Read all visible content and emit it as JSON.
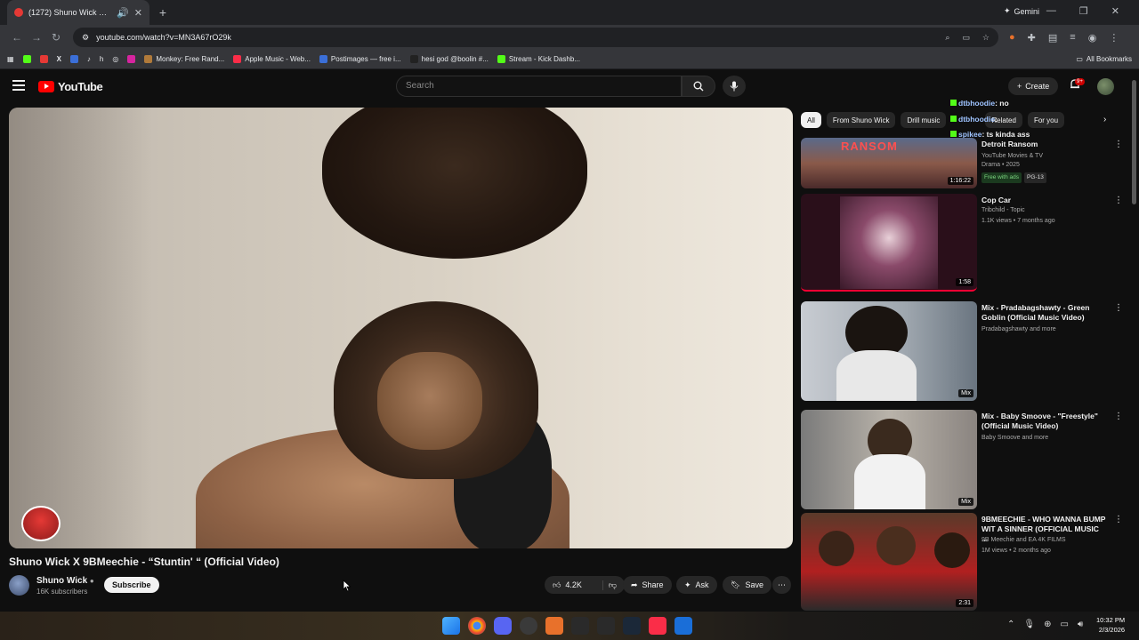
{
  "browser": {
    "tab_title": "(1272) Shuno Wick X 9BMe...",
    "gemini_label": "Gemini",
    "url": "youtube.com/watch?v=MN3A67rO29k"
  },
  "bookmarks": [
    {
      "label": "Monkey: Free Rand...",
      "color": "#b07a3a"
    },
    {
      "label": "Apple Music - Web...",
      "color": "#fa2d48"
    },
    {
      "label": "Postimages — free i...",
      "color": "#3b6fd8"
    },
    {
      "label": "hesi god @boolin #...",
      "color": "#222222"
    },
    {
      "label": "Stream - Kick Dashb...",
      "color": "#53fc18"
    }
  ],
  "all_bookmarks": "All Bookmarks",
  "youtube": {
    "logo_text": "YouTube",
    "search_placeholder": "Search",
    "create_label": "Create",
    "notif_badge": "9+"
  },
  "video": {
    "title": "Shuno Wick X 9BMeechie - “Stuntin' “ (Official Video)",
    "channel": "Shuno Wick",
    "subscribers": "16K subscribers",
    "subscribe_label": "Subscribe",
    "likes": "4.2K",
    "share_label": "Share",
    "ask_label": "Ask",
    "save_label": "Save"
  },
  "chips": [
    "All",
    "From Shuno Wick",
    "Drill music",
    "Related",
    "For you"
  ],
  "chat": [
    {
      "user": "dtbhoodie",
      "msg": ": no"
    },
    {
      "user": "dtbhoodie",
      "msg": ": "
    },
    {
      "user": "spikee",
      "msg": ": ts kinda ass"
    }
  ],
  "recommendations": [
    {
      "title": "Detroit Ransom",
      "meta1": "YouTube Movies & TV",
      "meta2": "Drama • 2025",
      "free": "Free with ads",
      "rating": "PG-13",
      "duration": "1:16:22"
    },
    {
      "title": "Cop Car",
      "meta1": "Tribchild - Topic",
      "meta2": "1.1K views • 7 months ago",
      "duration": "1:58"
    },
    {
      "title": "Mix - Pradabagshawty - Green Goblin (Official Music Video)",
      "meta1": "Pradabagshawty and more",
      "meta2": "",
      "duration": "Mix"
    },
    {
      "title": "Mix - Baby Smoove - \"Freestyle\" (Official Music Video)",
      "meta1": "Baby Smoove and more",
      "meta2": "",
      "duration": "Mix"
    },
    {
      "title": "9BMEECHIE - WHO WANNA BUMP WIT A SINNER (OFFICIAL MUSIC ...",
      "meta1": "9B Meechie and EA 4K FILMS",
      "meta2": "1M views • 2 months ago",
      "duration": "2:31"
    }
  ],
  "taskbar": {
    "time": "10:32 PM",
    "date": "2/3/2026"
  }
}
